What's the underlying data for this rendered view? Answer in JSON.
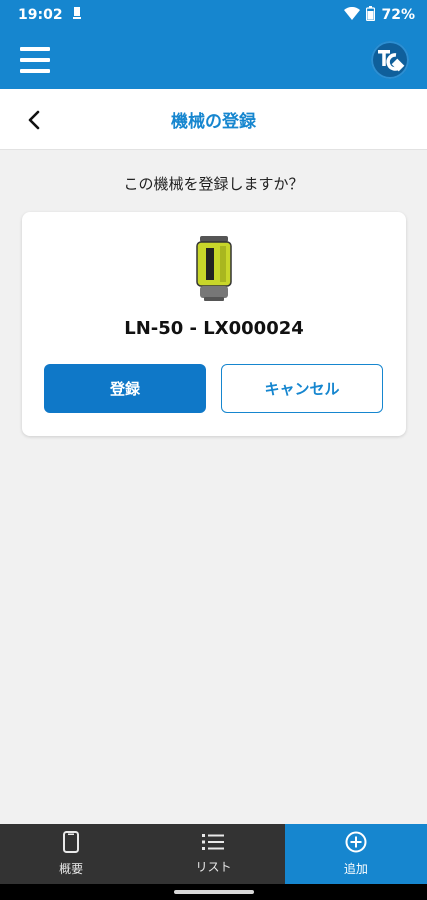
{
  "status_bar": {
    "time": "19:02",
    "battery": "72%",
    "icons": [
      "notification-icon",
      "wifi-icon",
      "battery-icon"
    ]
  },
  "app_bar": {
    "menu_icon": "hamburger-icon",
    "logo_icon": "tc-app-icon"
  },
  "title_bar": {
    "back_icon": "back-chevron-icon",
    "title": "機械の登録"
  },
  "main": {
    "prompt": "この機械を登録しますか？",
    "device": {
      "image_icon": "laser-device-icon",
      "name": "LN-50 - LX000024"
    },
    "buttons": {
      "register_label": "登録",
      "cancel_label": "キャンセル"
    }
  },
  "bottom_nav": {
    "items": [
      {
        "label": "概要",
        "icon": "phone-icon",
        "active": false
      },
      {
        "label": "リスト",
        "icon": "list-icon",
        "active": false
      },
      {
        "label": "追加",
        "icon": "add-circle-icon",
        "active": true
      }
    ]
  },
  "colors": {
    "primary": "#1686cf",
    "button_primary": "#0f78c8",
    "nav_background": "#333333",
    "background": "#f1f1f1"
  }
}
